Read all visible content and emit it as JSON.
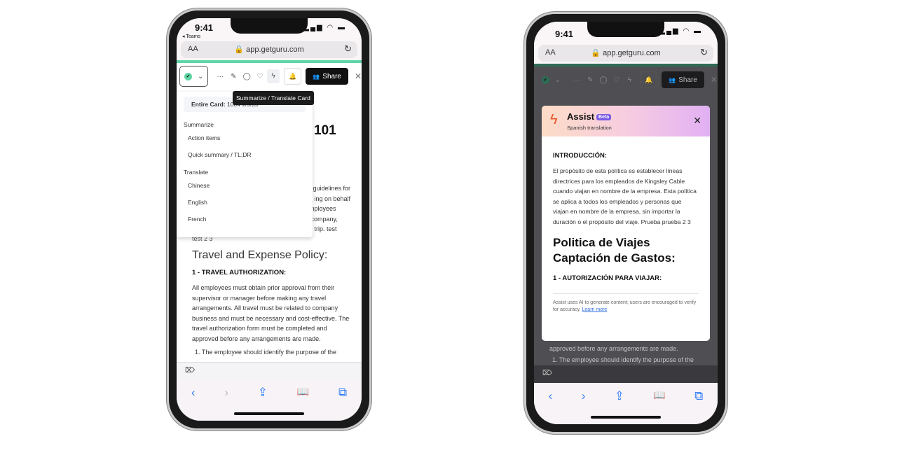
{
  "phones": [
    {
      "status": {
        "time": "9:41",
        "back_app": "◂ Teams",
        "signal": "▂▄▆ ◠ ▬"
      },
      "browser": {
        "aa": "AA",
        "url": "🔒 app.getguru.com",
        "reload_icon": "↻"
      },
      "toolbar": {
        "more": "···",
        "edit": "✎",
        "comment": "◯",
        "favorite": "♡",
        "assist": "ϟ",
        "bell": "🔔",
        "share": "Share",
        "share_icon": "👥",
        "close": "✕",
        "status_chevron": "⌄",
        "check": "✔"
      },
      "tooltip": "Summarize / Translate Card",
      "dropdown": {
        "entire_label": "Entire Card:",
        "entire_value": "1004 words",
        "summarize_heading": "Summarize",
        "summarize_items": [
          "Action items",
          "Quick summary / TL;DR"
        ],
        "translate_heading": "Translate",
        "translate_items": [
          "Chinese",
          "English",
          "French"
        ]
      },
      "card": {
        "title_fragment": "101",
        "intro_fragments": [
          "guidelines for",
          "ing on behalf",
          "employees",
          "e company,",
          "he trip. test",
          "test 2 3"
        ],
        "policy_title": "Travel and Expense Policy:",
        "section1": "1 - TRAVEL AUTHORIZATION:",
        "section1_body": "All employees must obtain prior approval from their supervisor or manager before making any travel arrangements. All travel must be related to company business and must be necessary and cost-effective. The travel authorization form must be completed and approved before any arrangements are made.",
        "list_item": "1.   The employee should identify the purpose of the"
      },
      "bottom": {
        "tag_icon": "⌦",
        "back": "‹",
        "forward": "›",
        "share": "⇪",
        "bookmarks": "📖",
        "tabs": "⧉"
      }
    },
    {
      "status": {
        "time": "9:41",
        "signal": "▂▄▆ ◠ ▬"
      },
      "browser": {
        "aa": "AA",
        "url": "🔒 app.getguru.com",
        "reload_icon": "↻"
      },
      "toolbar": {
        "more": "···",
        "edit": "✎",
        "comment": "◯",
        "favorite": "♡",
        "assist": "ϟ",
        "bell": "🔔",
        "share": "Share",
        "share_icon": "👥",
        "close": "✕",
        "status_chevron": "⌄",
        "check": "✔"
      },
      "assist": {
        "title": "Assist",
        "badge": "Beta",
        "subtitle": "Spanish translation",
        "close": "✕",
        "heading1": "INTRODUCCIÓN:",
        "para1": "El propósito de esta política es establecer líneas directrices para los empleados de Kingsley Cable cuando viajan en nombre de la empresa. Esta política se aplica a todos los empleados y personas que viajan en nombre de la empresa, sin importar la duración o el propósito del viaje. Prueba prueba 2 3",
        "title2": "Politica de Viajes Captación de Gastos:",
        "heading2": "1 - AUTORIZACIÓN PARA VIAJAR:",
        "disclaimer": "Assist uses AI to generate content; users are encouraged to verify for accuracy.",
        "learn_more": "Learn more"
      },
      "background_text": [
        "approved before any arrangements are made.",
        "1.   The employee should identify the purpose of the"
      ],
      "bottom": {
        "tag_icon": "⌦",
        "back": "‹",
        "forward": "›",
        "share": "⇪",
        "bookmarks": "📖",
        "tabs": "⧉"
      }
    }
  ],
  "colors": {
    "accent_green": "#5ed6a5",
    "beta_purple": "#7b5ce6",
    "link_blue": "#2f6fe0",
    "ios_blue": "#2f7cf6"
  }
}
